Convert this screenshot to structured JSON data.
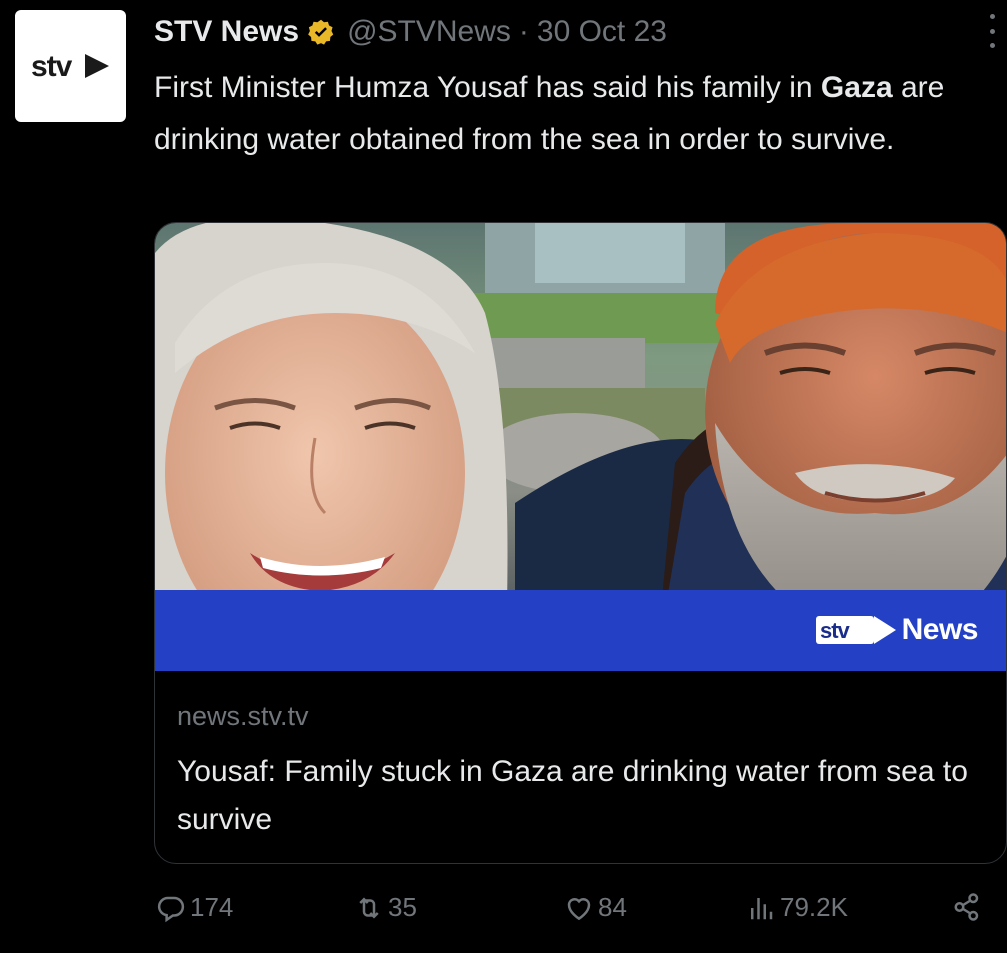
{
  "tweet": {
    "author_name": "STV News",
    "handle": "@STVNews",
    "separator": "·",
    "date": "30 Oct 23",
    "text_parts": [
      "First Minister Humza Yousaf has said his family in ",
      "Gaza",
      " are drinking water obtained from the sea in order to survive."
    ]
  },
  "card": {
    "banner_brand": "News",
    "logo_text": "stv",
    "domain": "news.stv.tv",
    "title": "Yousaf: Family stuck in Gaza are drinking water from sea to survive"
  },
  "actions": {
    "replies": "174",
    "reposts": "35",
    "likes": "84",
    "views": "79.2K"
  },
  "icons": [
    "stv-logo-icon",
    "verified-badge-icon",
    "more-options-icon",
    "reply-icon",
    "repost-icon",
    "like-icon",
    "views-icon",
    "share-icon"
  ],
  "colors": {
    "background": "#000000",
    "text": "#e7e9ea",
    "muted": "#71767b",
    "verified_gold": "#e8b829",
    "banner_blue": "#2440c4"
  }
}
